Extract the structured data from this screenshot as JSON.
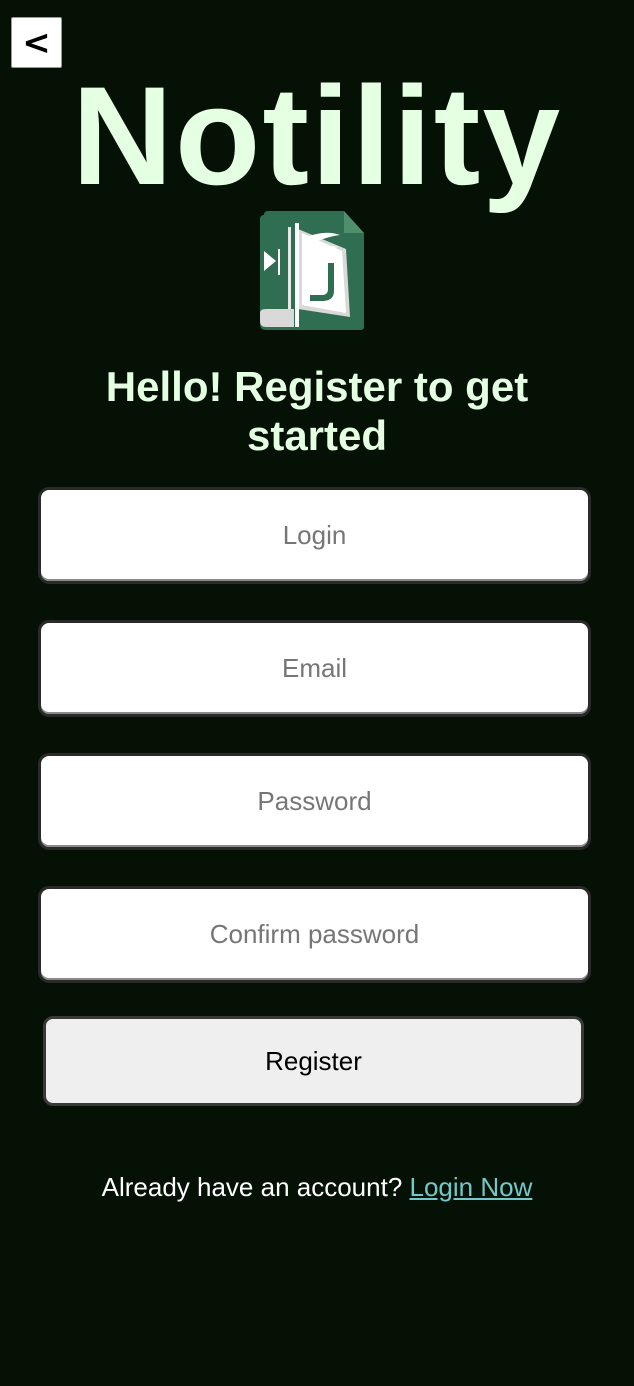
{
  "app": {
    "title": "Notility",
    "logo_icon": "green-notebook-logo-icon"
  },
  "nav": {
    "back_label": "<"
  },
  "form": {
    "heading": "Hello! Register to get started",
    "login_placeholder": "Login",
    "email_placeholder": "Email",
    "password_placeholder": "Password",
    "confirm_placeholder": "Confirm password",
    "register_label": "Register"
  },
  "footer": {
    "prompt": "Already have an account?",
    "link_label": "Login Now"
  },
  "colors": {
    "background": "#061106",
    "title_text": "#e4ffe1",
    "link": "#73c9c9",
    "logo_green": "#2f6e50"
  }
}
